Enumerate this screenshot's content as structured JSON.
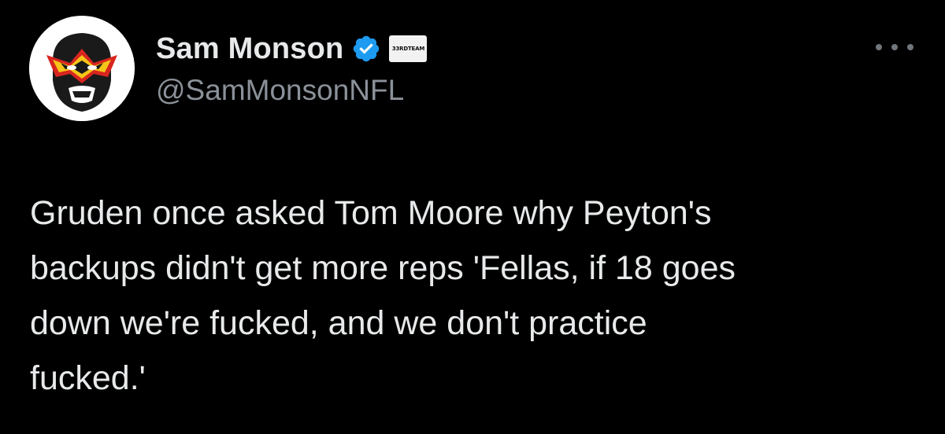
{
  "tweet": {
    "author": {
      "display_name": "Sam Monson",
      "handle": "@SamMonsonNFL",
      "verified": true,
      "verified_color": "#1d9bf0",
      "affiliation_badge": "33RDTEAM",
      "avatar_icon": "ultimate-warrior-face-paint-avatar"
    },
    "more_icon": "more-options-ellipsis-icon",
    "text": "Gruden once asked Tom Moore why Peyton's\nbackups didn't get more reps 'Fellas, if 18 goes\ndown we're fucked, and we don't practice\nfucked.'"
  },
  "colors": {
    "background": "#000000",
    "primary_text": "#e7e9ea",
    "secondary_text": "#8b9199"
  }
}
